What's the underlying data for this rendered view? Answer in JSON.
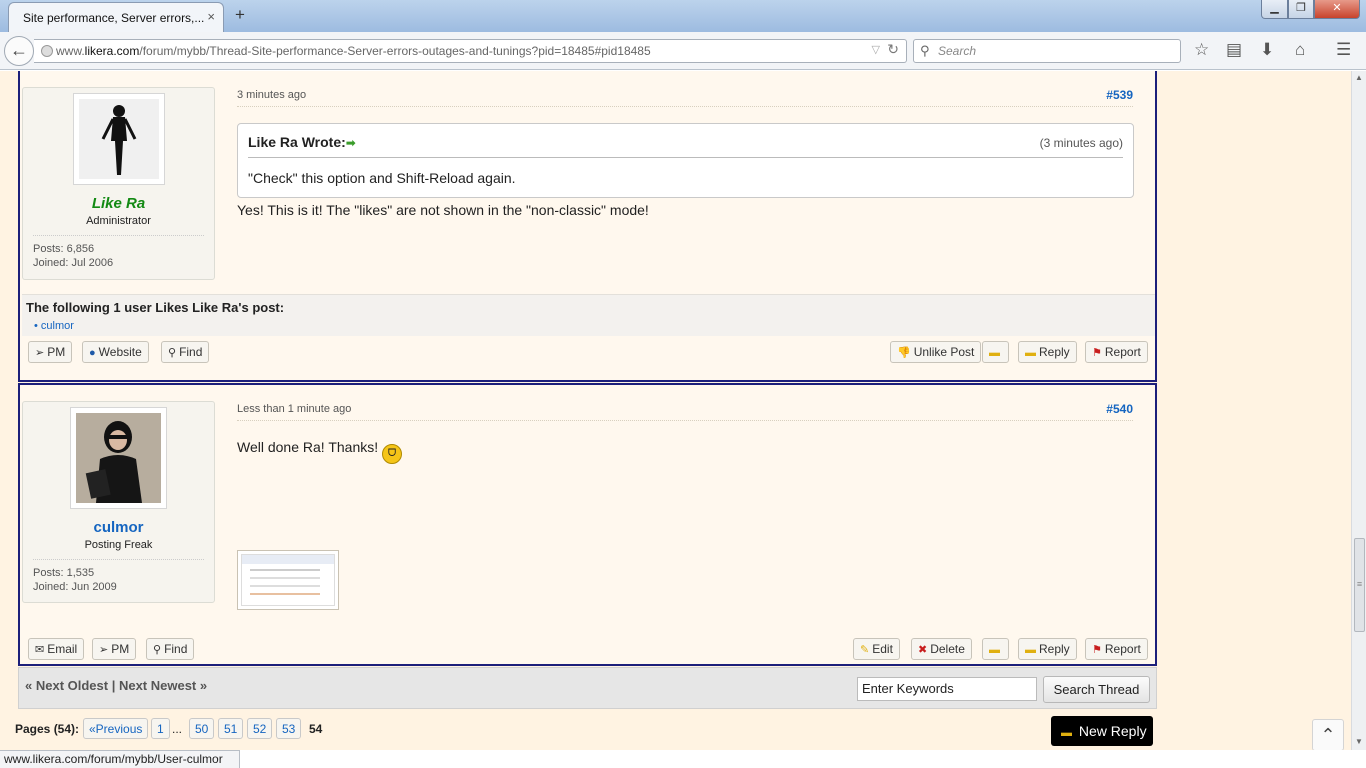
{
  "browser": {
    "tab_title": "Site performance, Server errors,...",
    "tab_close": "×",
    "new_tab": "+",
    "url_prefix": "www.",
    "url_domain": "likera.com",
    "url_path": "/forum/mybb/Thread-Site-performance-Server-errors-outages-and-tunings?pid=18485#pid18485",
    "search_placeholder": "Search",
    "status_url": "www.likera.com/forum/mybb/User-culmor"
  },
  "posts": [
    {
      "number": "#539",
      "time": "3 minutes ago",
      "author": {
        "name": "Like Ra",
        "name_color": "#138a13",
        "title": "Administrator",
        "posts_label": "Posts: 6,856",
        "joined_label": "Joined: Jul 2006"
      },
      "quote": {
        "author": "Like Ra Wrote:",
        "time": "(3 minutes ago)",
        "text": "\"Check\" this option and Shift-Reload again."
      },
      "body": "Yes! This is it! The \"likes\" are not shown in the \"non-classic\" mode!",
      "likes": {
        "heading": "The following 1 user Likes Like Ra's post:",
        "users": [
          "culmor"
        ]
      },
      "buttons_left": [
        "PM",
        "Website",
        "Find"
      ],
      "buttons_right": [
        "Unlike Post",
        "",
        "Reply",
        "Report"
      ]
    },
    {
      "number": "#540",
      "time": "Less than 1 minute ago",
      "author": {
        "name": "culmor",
        "name_color": "#1565c0",
        "title": "Posting Freak",
        "posts_label": "Posts: 1,535",
        "joined_label": "Joined: Jun 2009"
      },
      "body": "Well done Ra! Thanks!",
      "buttons_left": [
        "Email",
        "PM",
        "Find"
      ],
      "buttons_right": [
        "Edit",
        "Delete",
        "",
        "Reply",
        "Report"
      ]
    }
  ],
  "thread_nav": {
    "text": "« Next Oldest | Next Newest »",
    "search_value": "Enter Keywords",
    "search_button": "Search Thread"
  },
  "pagination": {
    "label": "Pages (54):",
    "previous": "«Previous",
    "first": "1",
    "ellipsis": "...",
    "pages": [
      "50",
      "51",
      "52",
      "53"
    ],
    "current": "54"
  },
  "new_reply": "New Reply",
  "colors": {
    "accent": "#1565c0",
    "post_border": "#1c1f7a",
    "page_bg": "#fff3e2"
  }
}
